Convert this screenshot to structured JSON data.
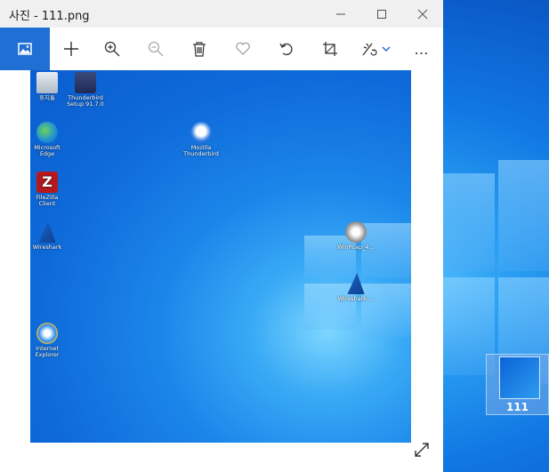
{
  "window": {
    "title": "사진 - 111.png"
  },
  "desktop": {
    "thumbnail_label": "111"
  },
  "photo_icons": [
    {
      "label": "휴지통"
    },
    {
      "label": "Thunderbird Setup 91.7.0"
    },
    {
      "label": "Microsoft Edge"
    },
    {
      "label": "Mozilla Thunderbird"
    },
    {
      "label": "FileZilla Client"
    },
    {
      "label": "Wireshark"
    },
    {
      "label": "WinPcap_4..."
    },
    {
      "label": "Wireshark-..."
    },
    {
      "label": "Internet Explorer"
    }
  ],
  "toolbar": {
    "more_label": "…"
  },
  "colors": {
    "accent": "#1f6fd4",
    "titlebar": "#f0f0f0"
  }
}
